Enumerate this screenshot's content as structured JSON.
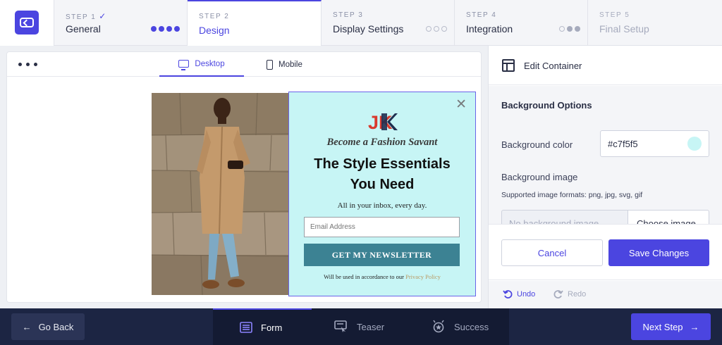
{
  "steps": [
    {
      "num": "STEP 1",
      "name": "General",
      "check": "✓"
    },
    {
      "num": "STEP 2",
      "name": "Design"
    },
    {
      "num": "STEP 3",
      "name": "Display Settings"
    },
    {
      "num": "STEP 4",
      "name": "Integration"
    },
    {
      "num": "STEP 5",
      "name": "Final Setup"
    }
  ],
  "preview": {
    "tabs": {
      "desktop": "Desktop",
      "mobile": "Mobile"
    },
    "popup": {
      "logo_text": "JK",
      "tagline": "Become a Fashion Savant",
      "headline_line1": "The Style Essentials",
      "headline_line2": "You Need",
      "subtext": "All in your inbox, every day.",
      "email_placeholder": "Email Address",
      "cta": "GET MY NEWSLETTER",
      "legal_prefix": "Will be used in accordance to our ",
      "legal_link": "Privacy Policy",
      "close": "✕",
      "background": "#c7f5f5"
    }
  },
  "side": {
    "title": "Edit Container",
    "section": "Background Options",
    "bg_color_label": "Background color",
    "bg_color_value": "#c7f5f5",
    "bg_image_label": "Background image",
    "formats": "Supported image formats: png, jpg, svg, gif",
    "image_placeholder": "No background image",
    "choose_image": "Choose image",
    "cancel": "Cancel",
    "save": "Save Changes",
    "undo": "Undo",
    "redo": "Redo"
  },
  "bottom": {
    "go_back": "Go Back",
    "tabs": {
      "form": "Form",
      "teaser": "Teaser",
      "success": "Success"
    },
    "next": "Next Step"
  },
  "colors": {
    "accent": "#4b45e0",
    "navy": "#1c2543",
    "cta": "#3c8293"
  }
}
